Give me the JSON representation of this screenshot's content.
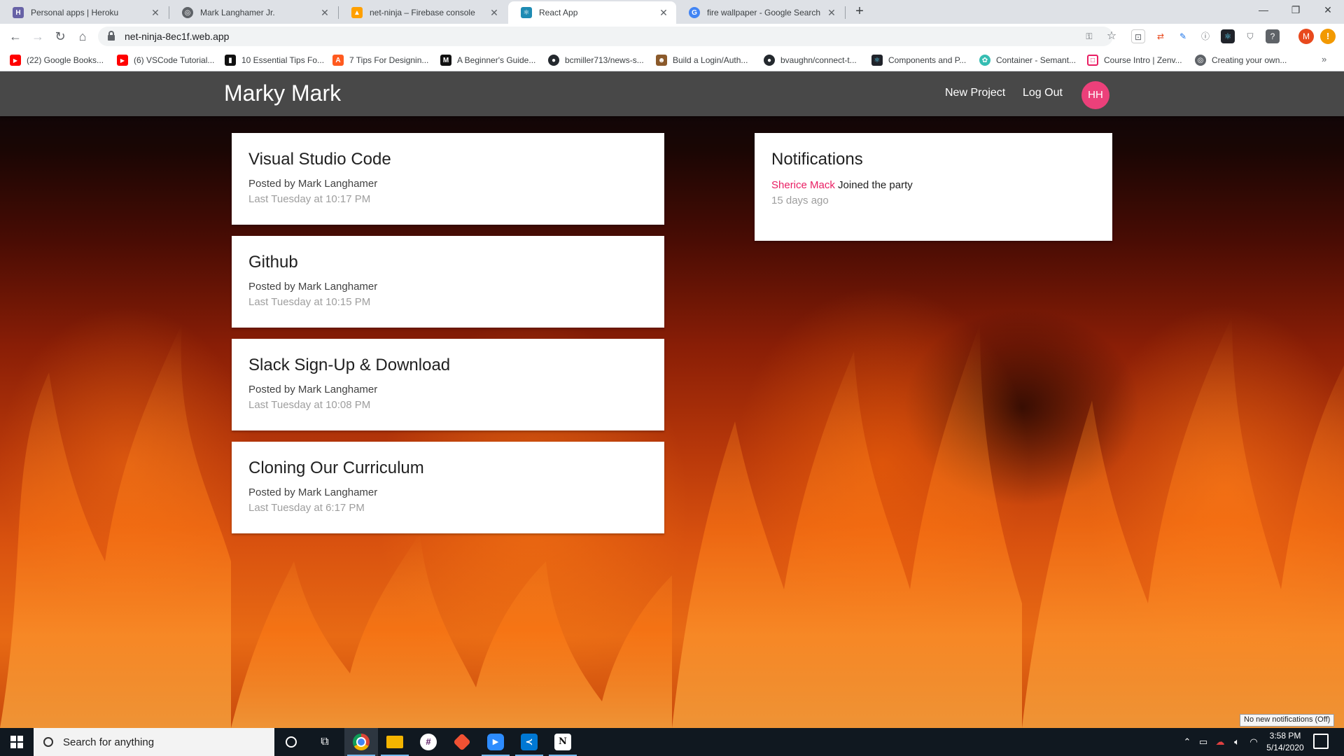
{
  "browser": {
    "tabs": [
      {
        "title": "Personal apps | Heroku",
        "icon": "heroku-icon",
        "color": "#6762a6",
        "glyph": "H"
      },
      {
        "title": "Mark Langhamer Jr.",
        "icon": "globe-icon",
        "color": "#5f6368",
        "glyph": "◎"
      },
      {
        "title": "net-ninja – Firebase console",
        "icon": "firebase-icon",
        "color": "#ffa000",
        "glyph": "▲"
      },
      {
        "title": "React App",
        "icon": "react-icon",
        "color": "#1e8bb3",
        "glyph": "⚛"
      },
      {
        "title": "fire wallpaper - Google Search",
        "icon": "google-icon",
        "color": "#4285f4",
        "glyph": "G"
      }
    ],
    "active_tab": 3,
    "url": "net-ninja-8ec1f.web.app",
    "bookmarks": [
      {
        "label": "(22) Google Books...",
        "icon": "youtube-icon",
        "color": "#ff0000",
        "glyph": "▶"
      },
      {
        "label": "(6) VSCode Tutorial...",
        "icon": "youtube-icon",
        "color": "#ff0000",
        "glyph": "▶"
      },
      {
        "label": "10 Essential Tips Fo...",
        "icon": "site-icon",
        "color": "#111111",
        "glyph": "▮"
      },
      {
        "label": "7 Tips For Designin...",
        "icon": "site-a-icon",
        "color": "#ff5a1f",
        "glyph": "A"
      },
      {
        "label": "A Beginner's Guide...",
        "icon": "medium-icon",
        "color": "#111111",
        "glyph": "M"
      },
      {
        "label": "bcmiller713/news-s...",
        "icon": "github-icon",
        "color": "#24292e",
        "glyph": "●"
      },
      {
        "label": "Build a Login/Auth...",
        "icon": "site-icon",
        "color": "#8b5a2b",
        "glyph": "☻"
      },
      {
        "label": "bvaughn/connect-t...",
        "icon": "github-icon",
        "color": "#24292e",
        "glyph": "●"
      },
      {
        "label": "Components and P...",
        "icon": "react-icon",
        "color": "#20232a",
        "glyph": "⚛"
      },
      {
        "label": "Container - Semant...",
        "icon": "semantic-icon",
        "color": "#35bdb2",
        "glyph": "✿"
      },
      {
        "label": "Course Intro | Zenv...",
        "icon": "zenva-icon",
        "color": "#e91e63",
        "glyph": "□"
      },
      {
        "label": "Creating your own...",
        "icon": "globe-icon",
        "color": "#5f6368",
        "glyph": "◎"
      }
    ],
    "bookmarks_more": "»",
    "profile_initial": "M",
    "warning_glyph": "!"
  },
  "app": {
    "brand": "Marky Mark",
    "nav": {
      "new_project": "New Project",
      "log_out": "Log Out",
      "avatar_initials": "HH"
    },
    "projects": [
      {
        "title": "Visual Studio Code",
        "posted_by": "Posted by Mark Langhamer",
        "date": "Last Tuesday at 10:17 PM"
      },
      {
        "title": "Github",
        "posted_by": "Posted by Mark Langhamer",
        "date": "Last Tuesday at 10:15 PM"
      },
      {
        "title": "Slack Sign-Up & Download",
        "posted_by": "Posted by Mark Langhamer",
        "date": "Last Tuesday at 10:08 PM"
      },
      {
        "title": "Cloning Our Curriculum",
        "posted_by": "Posted by Mark Langhamer",
        "date": "Last Tuesday at 6:17 PM"
      }
    ],
    "notifications": {
      "title": "Notifications",
      "items": [
        {
          "user": "Sherice Mack",
          "content": "Joined the party",
          "time": "15 days ago"
        }
      ]
    },
    "colors": {
      "navbar": "#484848",
      "accent": "#ec407a",
      "link": "#e91e63"
    }
  },
  "os": {
    "search_placeholder": "Search for anything",
    "clock_time": "3:58 PM",
    "clock_date": "5/14/2020",
    "toast": "No new notifications (Off)",
    "taskbar_apps": [
      {
        "name": "cortana-icon",
        "glyph": "○",
        "color": "transparent"
      },
      {
        "name": "task-view-icon",
        "glyph": "⧉",
        "color": "transparent"
      },
      {
        "name": "chrome-icon",
        "glyph": "◉",
        "color": "#db4437"
      },
      {
        "name": "file-explorer-icon",
        "glyph": "▬",
        "color": "#f4b400"
      },
      {
        "name": "slack-icon",
        "glyph": "#",
        "color": "#611f69"
      },
      {
        "name": "git-icon",
        "glyph": "◆",
        "color": "#f05133"
      },
      {
        "name": "zoom-icon",
        "glyph": "▶",
        "color": "#2d8cff"
      },
      {
        "name": "vscode-icon",
        "glyph": "≺",
        "color": "#0078d4"
      },
      {
        "name": "notion-icon",
        "glyph": "N",
        "color": "#111111"
      }
    ]
  }
}
